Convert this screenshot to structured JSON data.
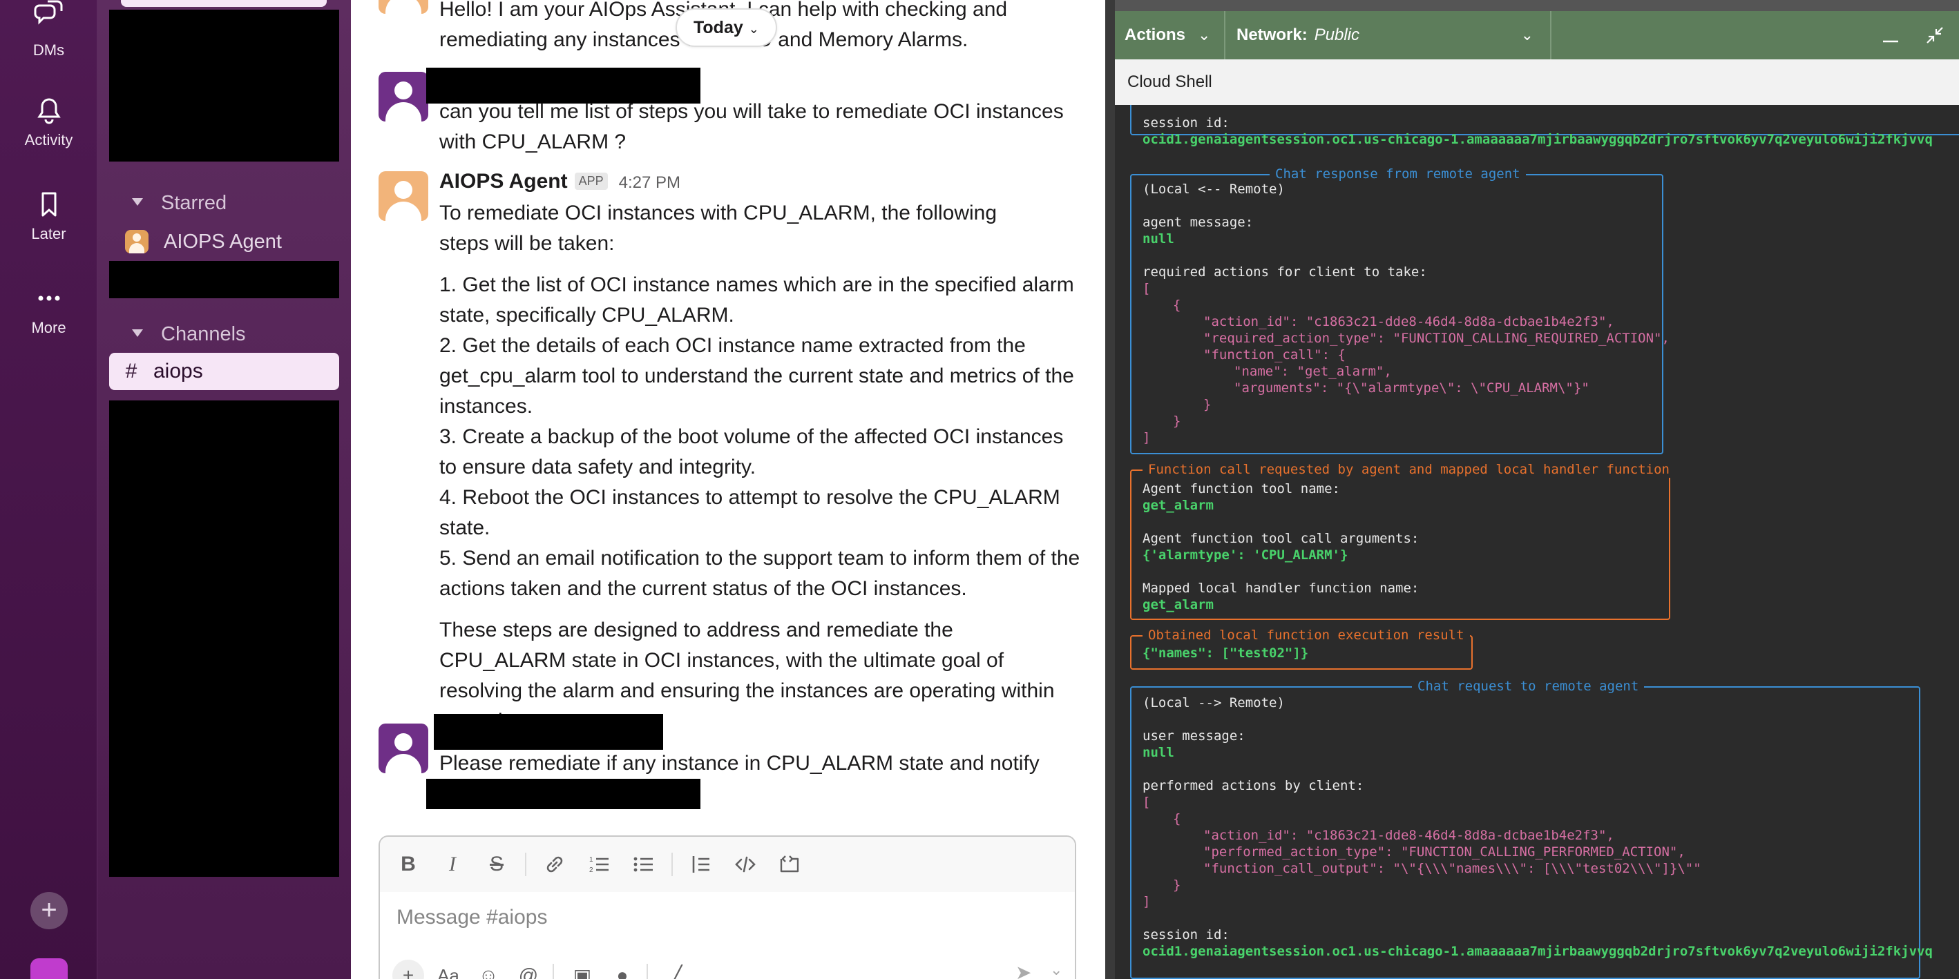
{
  "rail": {
    "dms_label": "DMs",
    "activity_label": "Activity",
    "later_label": "Later",
    "more_label": "More",
    "add_label": "+"
  },
  "sidebar": {
    "starred_label": "Starred",
    "starred_item": "AIOPS Agent",
    "channels_label": "Channels",
    "channel_item": "aiops",
    "channel_hash": "#"
  },
  "chat": {
    "today_label": "Today",
    "msg1_text": "Hello! I am your AIOps Assistant. I can help with checking and remediating any instances with CPU and Memory Alarms.",
    "msg2_text": "can you tell me list of steps you will take to remediate OCI instances with CPU_ALARM ?",
    "agent_name": "AIOPS Agent",
    "agent_badge": "APP",
    "agent_time": "4:27 PM",
    "agent_intro": "To remediate OCI instances with CPU_ALARM, the following steps will be taken:",
    "agent_steps": [
      "1. Get the list of OCI instance names which are in the specified alarm state, specifically CPU_ALARM.",
      "2. Get the details of each OCI instance name extracted from the get_cpu_alarm tool to understand the current state and metrics of the instances.",
      "3. Create a backup of the boot volume of the affected OCI instances to ensure data safety and integrity.",
      "4. Reboot the OCI instances to attempt to resolve the CPU_ALARM state.",
      "5. Send an email notification to the support team to inform them of the actions taken and the current status of the OCI instances."
    ],
    "agent_outro": "These steps are designed to address and remediate the CPU_ALARM state in OCI instances, with the ultimate goal of resolving the alarm and ensuring the instances are operating within normal parameters.",
    "msg3_text": "Please remediate if any instance in CPU_ALARM state and notify",
    "composer_placeholder": "Message #aiops"
  },
  "shell": {
    "actions_label": "Actions",
    "network_label": "Network:",
    "network_value": "Public",
    "title": "Cloud Shell",
    "session_label": "session id:",
    "session_id": "ocid1.genaiagentsession.oc1.us-chicago-1.amaaaaaa7mjirbaawyggqb2drjro7sftvok6yv7q2veyulo6wiji2fkjvvq",
    "resp_box_title": "Chat response from remote agent",
    "resp_dir": "(Local <-- Remote)",
    "agent_message_label": "agent message:",
    "null_value": "null",
    "required_actions_label": "required actions for client to take:",
    "bracket_open": "[",
    "brace_open": "{",
    "brace_close": "}",
    "bracket_close": "]",
    "req_action_id": "\"action_id\": \"c1863c21-dde8-46d4-8d8a-dcbae1b4e2f3\",",
    "req_action_type": "\"required_action_type\": \"FUNCTION_CALLING_REQUIRED_ACTION\",",
    "req_function_call": "\"function_call\": {",
    "req_name": "\"name\": \"get_alarm\",",
    "req_arguments": "\"arguments\": \"{\\\"alarmtype\\\": \\\"CPU_ALARM\\\"}\"",
    "fn_box_title": "Function call requested by agent and mapped local handler function",
    "fn_tool_name_label": "Agent function tool name:",
    "fn_tool_name": "get_alarm",
    "fn_args_label": "Agent function tool call arguments:",
    "fn_args": "{'alarmtype': 'CPU_ALARM'}",
    "fn_mapped_label": "Mapped local handler function name:",
    "fn_mapped": "get_alarm",
    "result_box_title": "Obtained local function execution result",
    "result_value": "{\"names\": [\"test02\"]}",
    "req_box_title": "Chat request to remote agent",
    "req_dir": "(Local --> Remote)",
    "user_message_label": "user message:",
    "performed_actions_label": "performed actions by client:",
    "perf_action_id": "\"action_id\": \"c1863c21-dde8-46d4-8d8a-dcbae1b4e2f3\",",
    "perf_action_type": "\"performed_action_type\": \"FUNCTION_CALLING_PERFORMED_ACTION\",",
    "perf_output": "\"function_call_output\": \"\\\"{\\\\\\\"names\\\\\\\": [\\\\\\\"test02\\\\\\\"]}\\\"\""
  },
  "colors": {
    "rail_bg": "#4a154b",
    "sidebar_bg": "#5c2b5e",
    "selected_channel_bg": "#f6e6f6",
    "shell_bar": "#5d7d5b",
    "term_green": "#49d26b",
    "term_pink": "#d66fa3",
    "box_blue": "#3b8fd4",
    "box_orange": "#e8712d"
  }
}
